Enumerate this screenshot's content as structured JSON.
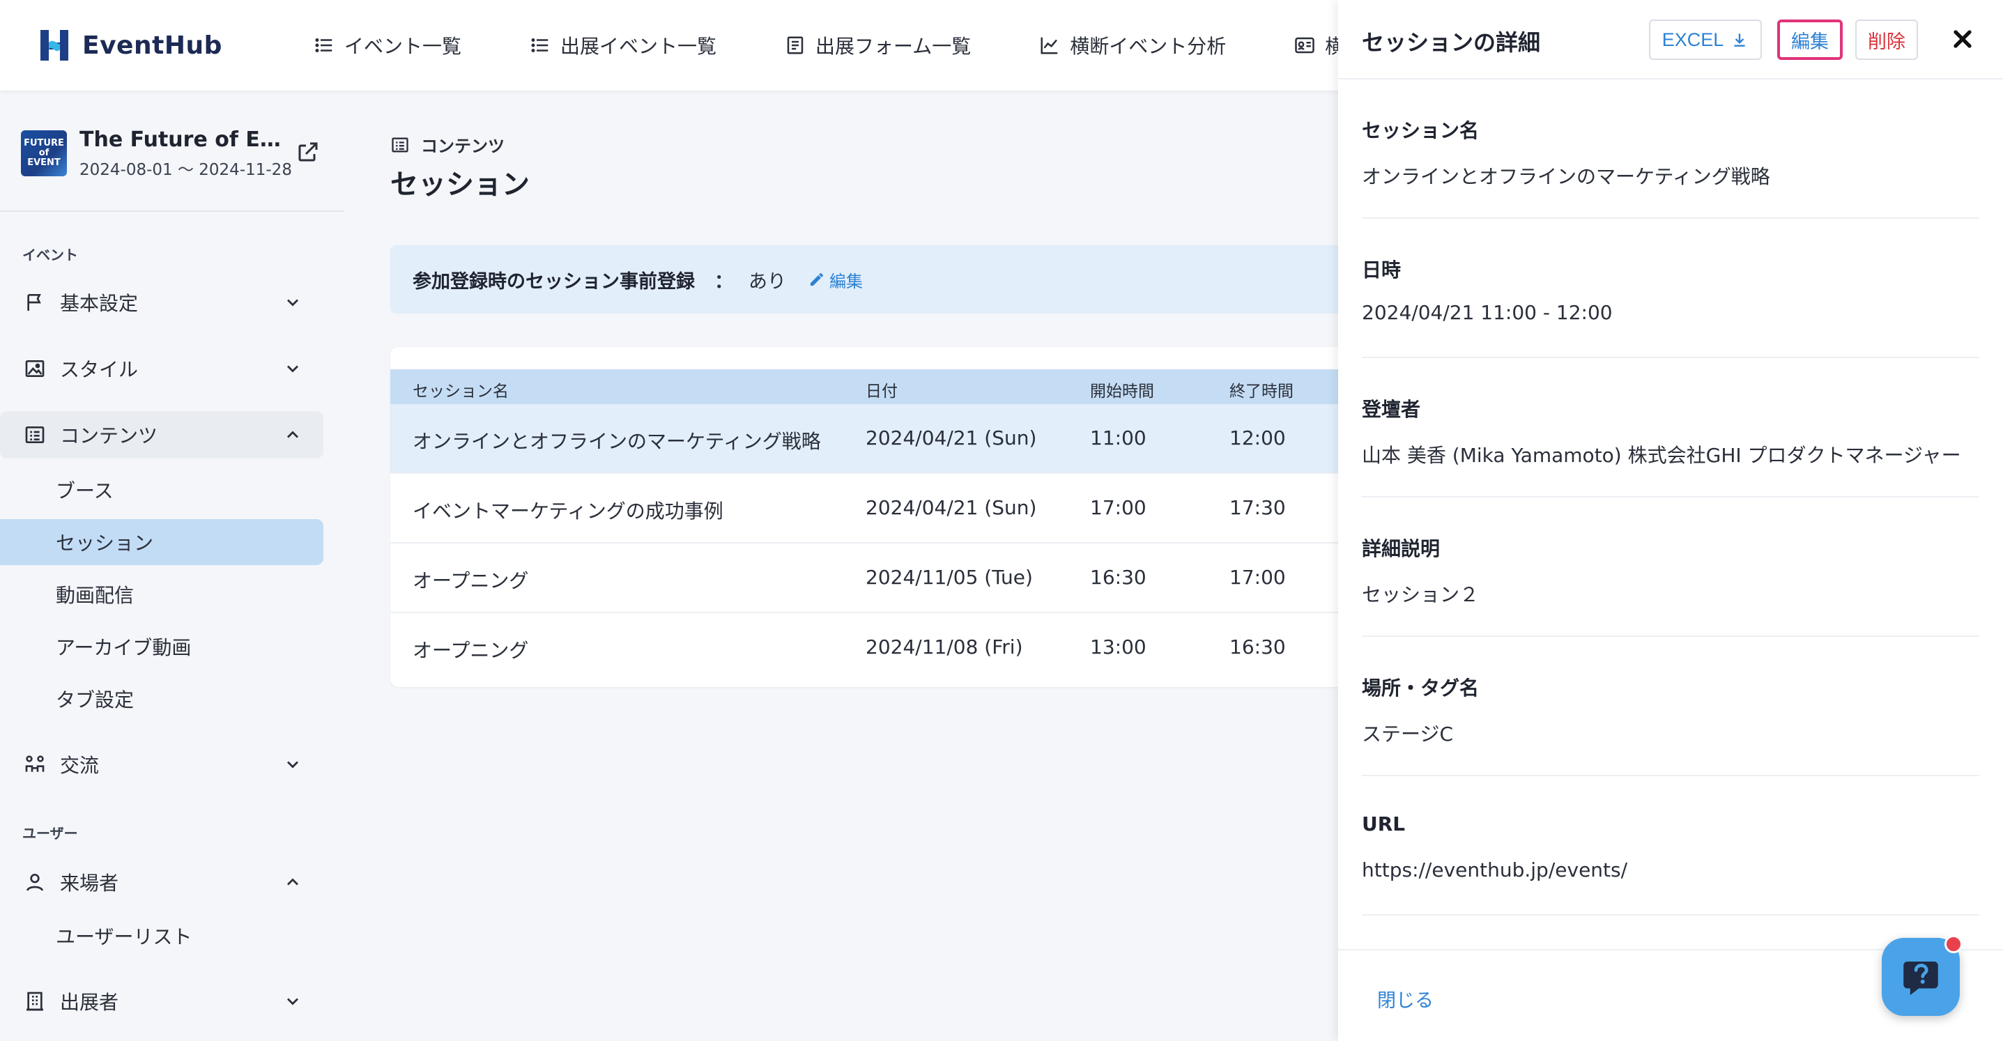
{
  "brand": {
    "name": "EventHub",
    "accent": "#2d82d4"
  },
  "topnav": [
    {
      "label": "イベント一覧",
      "icon": "list-icon"
    },
    {
      "label": "出展イベント一覧",
      "icon": "list-icon"
    },
    {
      "label": "出展フォーム一覧",
      "icon": "form-icon"
    },
    {
      "label": "横断イベント分析",
      "icon": "chart-icon"
    },
    {
      "label": "横",
      "icon": "id-card-icon"
    }
  ],
  "event": {
    "title": "The Future of Eve…",
    "dates": "2024-08-01 〜 2024-11-28",
    "thumb_text": "FUTURE of EVENT"
  },
  "sidebar": {
    "section_event": "イベント",
    "section_user": "ユーザー",
    "items": {
      "basic": "基本設定",
      "style": "スタイル",
      "contents": "コンテンツ",
      "exchange": "交流",
      "visitors": "来場者",
      "exhibitors": "出展者"
    },
    "contents_sub": [
      "ブース",
      "セッション",
      "動画配信",
      "アーカイブ動画",
      "タブ設定"
    ],
    "visitors_sub": [
      "ユーザーリスト"
    ]
  },
  "main": {
    "breadcrumb": "コンテンツ",
    "title": "セッション",
    "prereg": {
      "label": "参加登録時のセッション事前登録",
      "colon": "：",
      "value": "あり",
      "edit": "編集"
    },
    "table": {
      "headers": [
        "セッション名",
        "日付",
        "開始時間",
        "終了時間"
      ],
      "rows": [
        [
          "オンラインとオフラインのマーケティング戦略",
          "2024/04/21 (Sun)",
          "11:00",
          "12:00"
        ],
        [
          "イベントマーケティングの成功事例",
          "2024/04/21 (Sun)",
          "17:00",
          "17:30"
        ],
        [
          "オープニング",
          "2024/11/05 (Tue)",
          "16:30",
          "17:00"
        ],
        [
          "オープニング",
          "2024/11/08 (Fri)",
          "13:00",
          "16:30"
        ]
      ]
    }
  },
  "panel": {
    "title": "セッションの詳細",
    "excel": "EXCEL",
    "edit": "編集",
    "delete": "削除",
    "fields": [
      {
        "label": "セッション名",
        "value": "オンラインとオフラインのマーケティング戦略"
      },
      {
        "label": "日時",
        "value": "2024/04/21 11:00 - 12:00"
      },
      {
        "label": "登壇者",
        "value": "山本 美香 (Mika Yamamoto) 株式会社GHI プロダクトマネージャー"
      },
      {
        "label": "詳細説明",
        "value": "セッション２"
      },
      {
        "label": "場所・タグ名",
        "value": "ステージC"
      },
      {
        "label": "URL",
        "value": "https://eventhub.jp/events/"
      }
    ],
    "close": "閉じる"
  }
}
